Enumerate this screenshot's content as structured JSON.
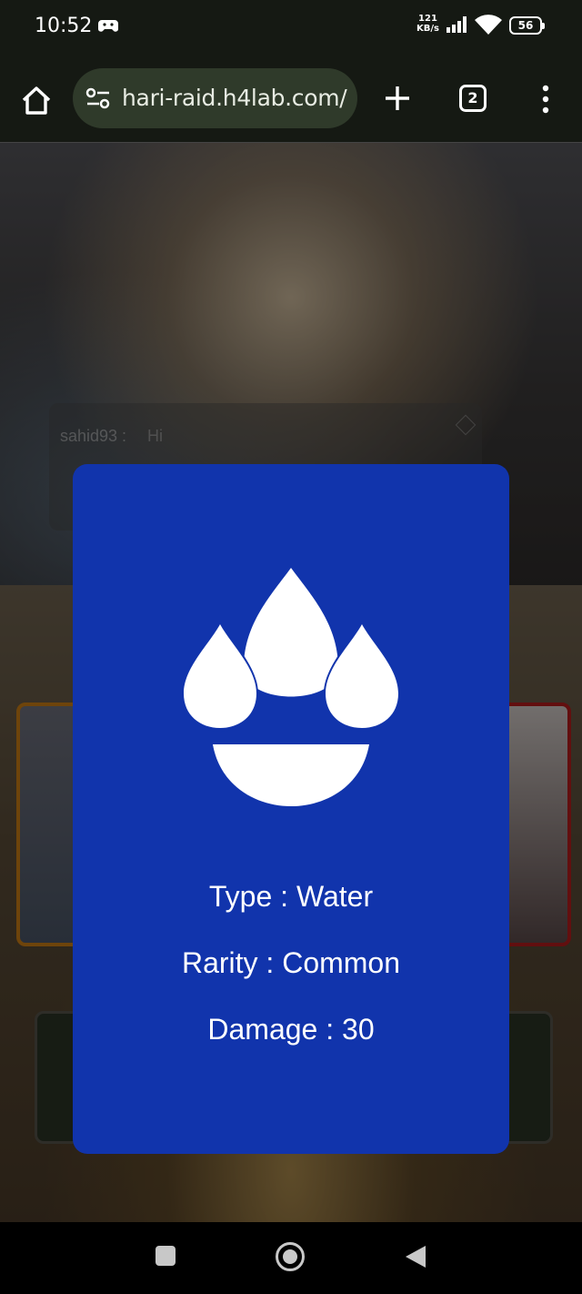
{
  "status_bar": {
    "time": "10:52",
    "net_speed_value": "121",
    "net_speed_unit": "KB/s",
    "battery": "56"
  },
  "browser": {
    "url": "hari-raid.h4lab.com/",
    "tab_count": "2"
  },
  "chat": {
    "username": "sahid93 :",
    "message": "Hi"
  },
  "card": {
    "type_label": "Type : Water",
    "rarity_label": "Rarity : Common",
    "damage_label": "Damage : 30",
    "icon": "water-element-icon",
    "background_color": "#1134ac"
  }
}
